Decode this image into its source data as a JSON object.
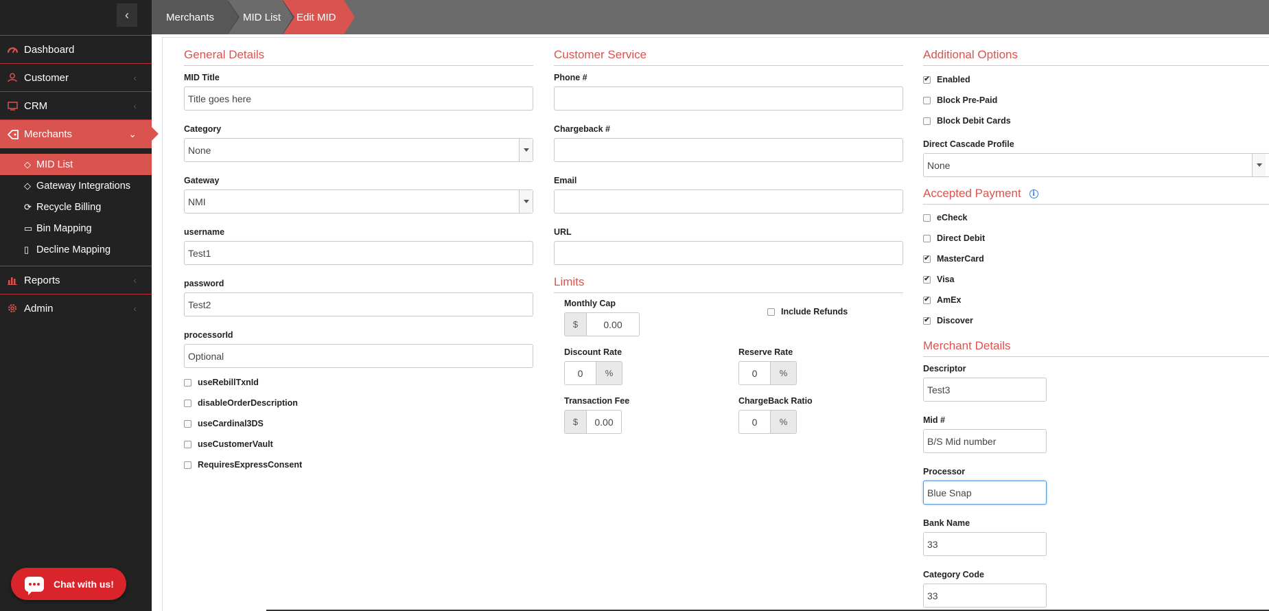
{
  "sidebar": {
    "collapse_icon": "chevron-left-icon",
    "items": [
      {
        "label": "Dashboard",
        "icon": "dashboard-icon"
      },
      {
        "label": "Customer",
        "icon": "user-icon"
      },
      {
        "label": "CRM",
        "icon": "monitor-icon"
      },
      {
        "label": "Merchants",
        "icon": "tag-icon"
      },
      {
        "label": "Reports",
        "icon": "bar-chart-icon"
      },
      {
        "label": "Admin",
        "icon": "gear-icon"
      }
    ],
    "sub_items": [
      {
        "label": "MID List",
        "icon": "tag-icon"
      },
      {
        "label": "Gateway Integrations",
        "icon": "tag-icon"
      },
      {
        "label": "Recycle Billing",
        "icon": "refresh-icon"
      },
      {
        "label": "Bin Mapping",
        "icon": "credit-card-icon"
      },
      {
        "label": "Decline Mapping",
        "icon": "map-icon"
      }
    ],
    "chat_label": "Chat with us!"
  },
  "breadcrumb": [
    "Merchants",
    "MID List",
    "Edit MID"
  ],
  "general": {
    "title": "General Details",
    "mid_title_label": "MID Title",
    "mid_title_value": "Title goes here",
    "category_label": "Category",
    "category_value": "None",
    "gateway_label": "Gateway",
    "gateway_value": "NMI",
    "username_label": "username",
    "username_value": "Test1",
    "password_label": "password",
    "password_value": "Test2",
    "processor_id_label": "processorId",
    "processor_id_placeholder": "Optional",
    "checks": [
      {
        "label": "useRebillTxnId",
        "checked": false
      },
      {
        "label": "disableOrderDescription",
        "checked": false
      },
      {
        "label": "useCardinal3DS",
        "checked": false
      },
      {
        "label": "useCustomerVault",
        "checked": false
      },
      {
        "label": "RequiresExpressConsent",
        "checked": false
      }
    ]
  },
  "customer_service": {
    "title": "Customer Service",
    "phone_label": "Phone #",
    "chargeback_label": "Chargeback #",
    "email_label": "Email",
    "url_label": "URL"
  },
  "limits": {
    "title": "Limits",
    "monthly_cap_label": "Monthly Cap",
    "monthly_cap_prefix": "$",
    "monthly_cap_value": "0.00",
    "include_refunds_label": "Include Refunds",
    "discount_rate_label": "Discount Rate",
    "discount_rate_value": "0",
    "discount_rate_suffix": "%",
    "reserve_rate_label": "Reserve Rate",
    "reserve_rate_value": "0",
    "reserve_rate_suffix": "%",
    "transaction_fee_label": "Transaction Fee",
    "transaction_fee_prefix": "$",
    "transaction_fee_value": "0.00",
    "chargeback_ratio_label": "ChargeBack Ratio",
    "chargeback_ratio_value": "0",
    "chargeback_ratio_suffix": "%"
  },
  "additional": {
    "title": "Additional Options",
    "checks": [
      {
        "label": "Enabled",
        "checked": true
      },
      {
        "label": "Block Pre-Paid",
        "checked": false
      },
      {
        "label": "Block Debit Cards",
        "checked": false
      }
    ],
    "cascade_label": "Direct Cascade Profile",
    "cascade_value": "None"
  },
  "accepted_payment": {
    "title": "Accepted Payment",
    "checks": [
      {
        "label": "eCheck",
        "checked": false
      },
      {
        "label": "Direct Debit",
        "checked": false
      },
      {
        "label": "MasterCard",
        "checked": true
      },
      {
        "label": "Visa",
        "checked": true
      },
      {
        "label": "AmEx",
        "checked": true
      },
      {
        "label": "Discover",
        "checked": true
      }
    ]
  },
  "merchant_details": {
    "title": "Merchant Details",
    "descriptor_label": "Descriptor",
    "descriptor_value": "Test3",
    "mid_label": "Mid #",
    "mid_value": "B/S Mid number",
    "processor_label": "Processor",
    "processor_value": "Blue Snap",
    "bank_label": "Bank Name",
    "bank_value": "33",
    "category_code_label": "Category Code",
    "category_code_value": "33"
  }
}
